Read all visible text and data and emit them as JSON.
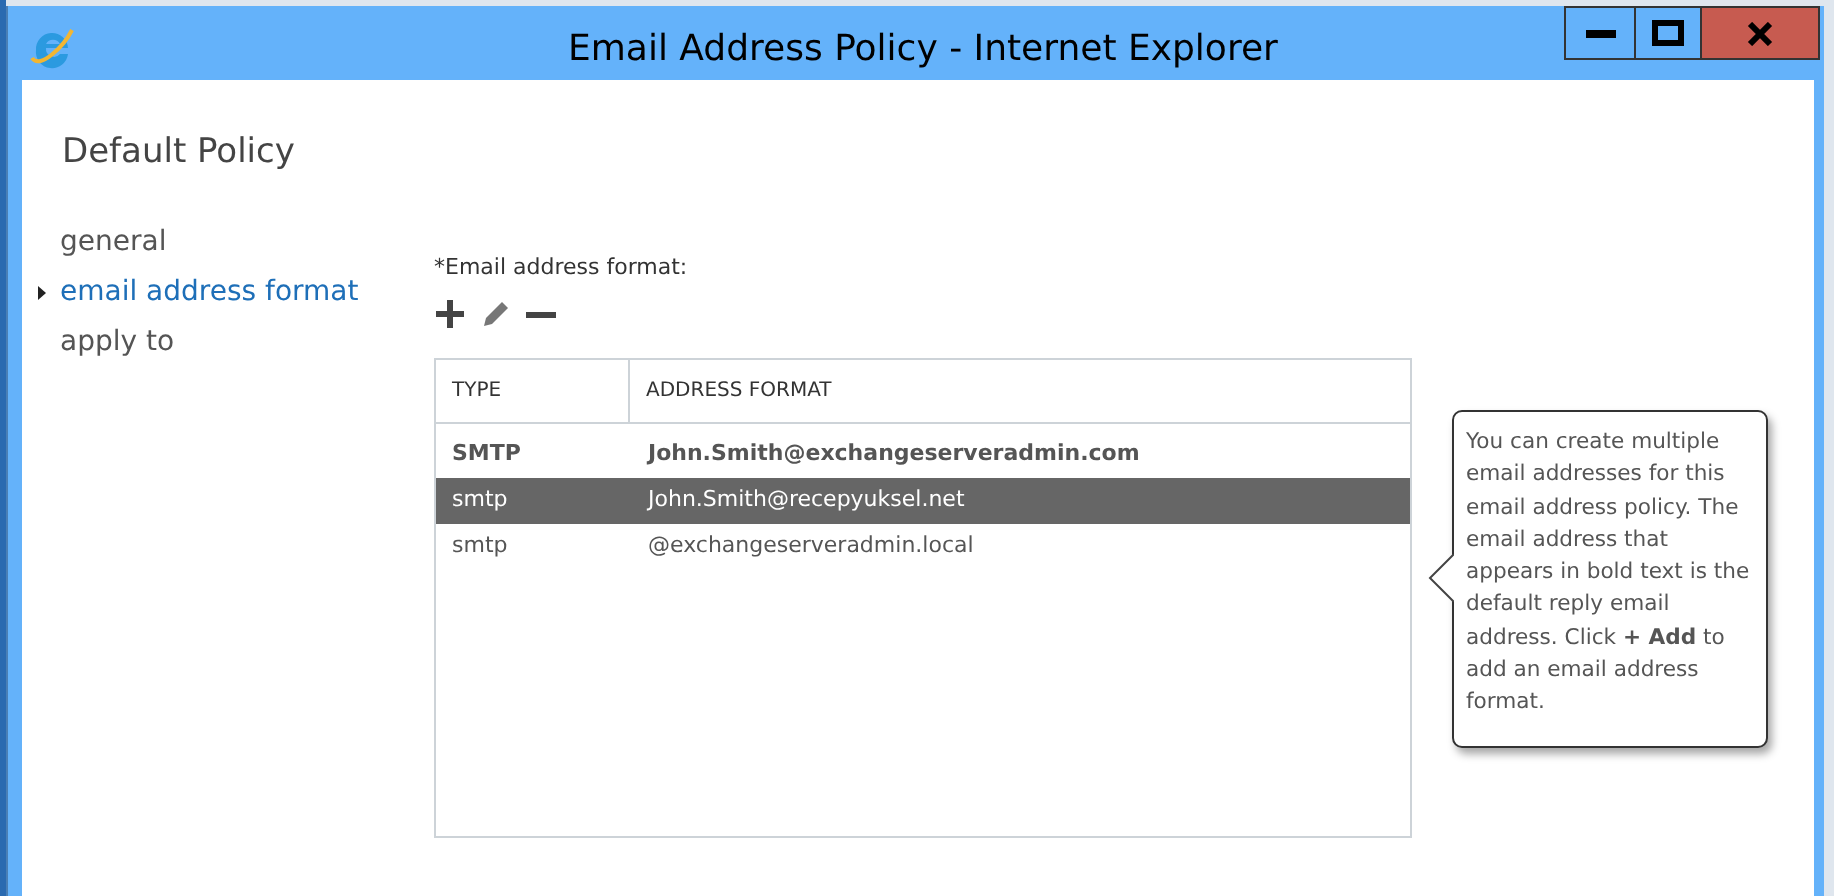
{
  "window": {
    "title": "Email Address Policy - Internet Explorer"
  },
  "page_title": "Default Policy",
  "nav": [
    {
      "label": "general",
      "selected": false
    },
    {
      "label": "email address format",
      "selected": true
    },
    {
      "label": "apply to",
      "selected": false
    }
  ],
  "field_label": "*Email address format:",
  "table": {
    "columns": [
      "TYPE",
      "ADDRESS FORMAT"
    ],
    "rows": [
      {
        "type": "SMTP",
        "address": "John.Smith@exchangeserveradmin.com",
        "default": true,
        "selected": false
      },
      {
        "type": "smtp",
        "address": "John.Smith@recepyuksel.net",
        "default": false,
        "selected": true
      },
      {
        "type": "smtp",
        "address": "@exchangeserveradmin.local",
        "default": false,
        "selected": false
      }
    ]
  },
  "tooltip": "You can create multiple email addresses for this email address policy. The email address that appears in bold text is the default reply email address. Click **+ Add** to add an email address format."
}
